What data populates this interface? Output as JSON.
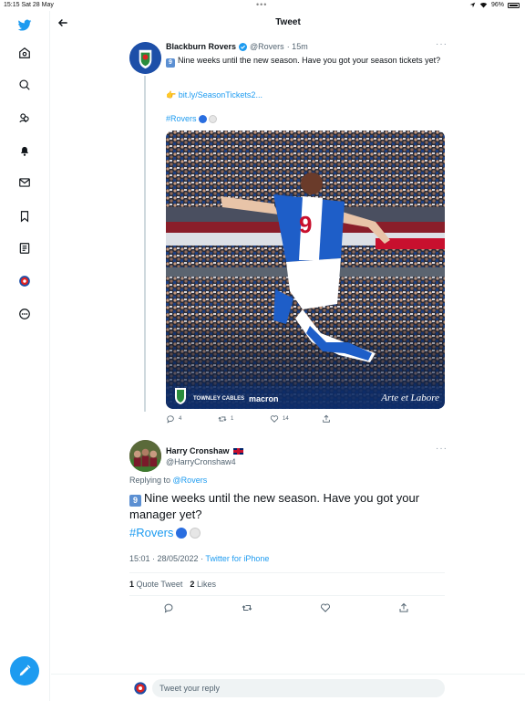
{
  "status_bar": {
    "time_date": "15:15  Sat 28 May",
    "battery": "96%"
  },
  "header": {
    "title": "Tweet"
  },
  "sidebar": {
    "items": [
      {
        "icon": "twitter-logo-icon"
      },
      {
        "icon": "home-icon"
      },
      {
        "icon": "explore-icon"
      },
      {
        "icon": "communities-icon"
      },
      {
        "icon": "notifications-icon"
      },
      {
        "icon": "messages-icon"
      },
      {
        "icon": "bookmarks-icon"
      },
      {
        "icon": "lists-icon"
      },
      {
        "icon": "profile-icon"
      },
      {
        "icon": "more-icon"
      }
    ],
    "compose_icon": "compose-tweet-icon"
  },
  "tweet1": {
    "name": "Blackburn Rovers",
    "handle": "@Rovers",
    "time": "· 15m",
    "keycap": "9",
    "text": "Nine weeks until the new season. Have you got your season tickets yet?",
    "link_emoji": "👉",
    "link": "bit.ly/SeasonTickets2...",
    "hashtag": "#Rovers",
    "image_texts": {
      "sponsor1": "TOWNLEY CABLES",
      "sponsor2": "macron",
      "motto": "Arte et Labore"
    },
    "counts": {
      "replies": "4",
      "retweets": "1",
      "likes": "14"
    }
  },
  "tweet2": {
    "name": "Harry Cronshaw",
    "handle": "@HarryCronshaw4",
    "replying_prefix": "Replying to",
    "replying_to": "@Rovers",
    "keycap": "9",
    "text": "Nine weeks until the new season. Have you got your manager yet?",
    "hashtag": "#Rovers",
    "timestamp": "15:01 · 28/05/2022 · ",
    "source": "Twitter for iPhone",
    "quote_count": "1",
    "quote_label": "Quote Tweet",
    "like_count": "2",
    "like_label": "Likes"
  },
  "reply_bar": {
    "placeholder": "Tweet your reply"
  },
  "colors": {
    "accent": "#1d9bf0",
    "rovers_blue": "#1d4fa8"
  }
}
